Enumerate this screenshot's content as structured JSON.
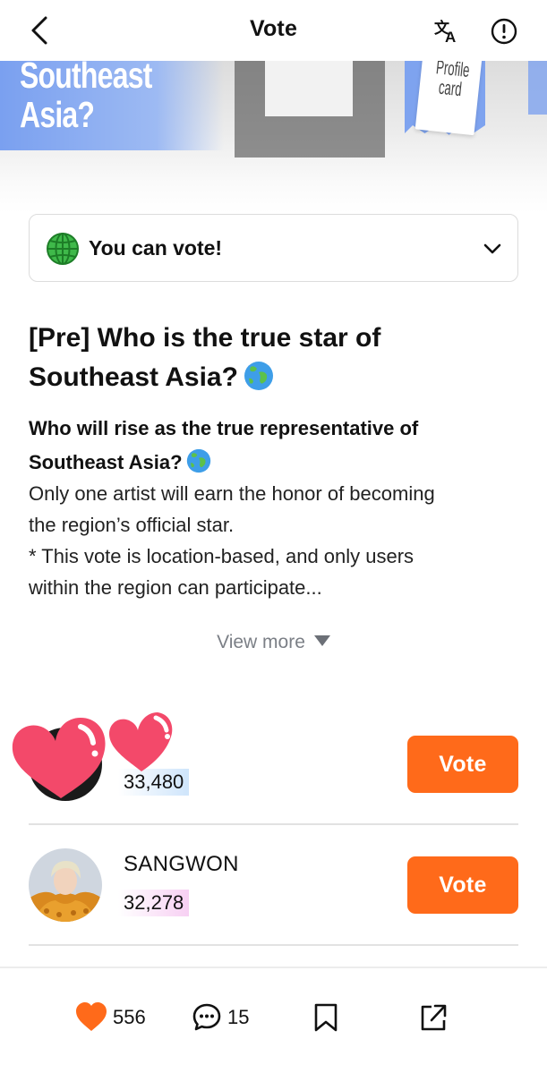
{
  "header": {
    "title": "Vote",
    "back_icon": "chevron-left-icon",
    "translate_icon": "translate-icon",
    "report_icon": "alert-circle-icon"
  },
  "banner": {
    "headline_line1": "Southeast",
    "headline_line2": "Asia?",
    "card_line1": "Profile",
    "card_line2": "card",
    "accent_color": "#7ea3ef"
  },
  "status": {
    "text": "You can vote!",
    "icon": "globe-emoji-icon"
  },
  "post": {
    "title_line1": "[Pre] Who is the true star of",
    "title_line2": "Southeast Asia?",
    "subtitle_line1": "Who will rise as the true representative of",
    "subtitle_line2": "Southeast Asia?",
    "body_lines": [
      "Only one artist will earn the honor of becoming",
      "the region’s official star.",
      "* This vote is location-based, and only users",
      "within the region can participate..."
    ],
    "view_more": "View more"
  },
  "candidates": [
    {
      "name": "",
      "votes": "33,480",
      "vote_label": "Vote",
      "bar_color": "#cfe5fb"
    },
    {
      "name": "SANGWON",
      "votes": "32,278",
      "vote_label": "Vote",
      "bar_color": "#f7d0f3"
    }
  ],
  "bottom_bar": {
    "likes": "556",
    "comments": "15",
    "like_color": "#ff6a1a"
  },
  "colors": {
    "vote_button": "#ff6a1a",
    "muted_text": "#7b7f86"
  }
}
